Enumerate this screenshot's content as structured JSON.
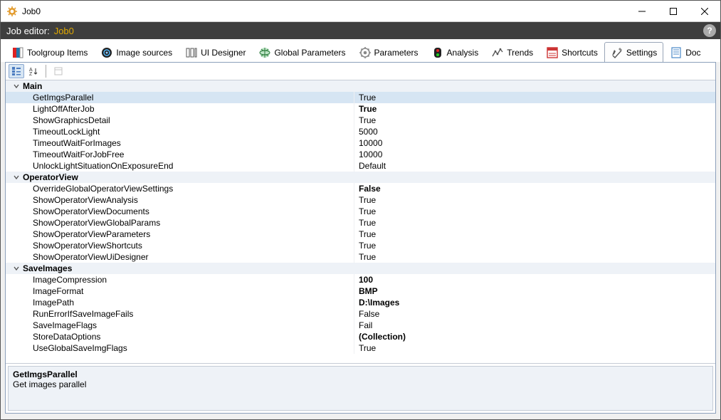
{
  "window": {
    "title": "Job0"
  },
  "editor": {
    "label": "Job editor:",
    "job_name": "Job0"
  },
  "tabs": [
    {
      "label": "Toolgroup Items"
    },
    {
      "label": "Image sources"
    },
    {
      "label": "UI Designer"
    },
    {
      "label": "Global Parameters"
    },
    {
      "label": "Parameters"
    },
    {
      "label": "Analysis"
    },
    {
      "label": "Trends"
    },
    {
      "label": "Shortcuts"
    },
    {
      "label": "Settings"
    },
    {
      "label": "Doc"
    }
  ],
  "categories": [
    {
      "name": "Main",
      "props": [
        {
          "name": "GetImgsParallel",
          "value": "True",
          "bold": false,
          "selected": true
        },
        {
          "name": "LightOffAfterJob",
          "value": "True",
          "bold": true
        },
        {
          "name": "ShowGraphicsDetail",
          "value": "True",
          "bold": false
        },
        {
          "name": "TimeoutLockLight",
          "value": "5000",
          "bold": false
        },
        {
          "name": "TimeoutWaitForImages",
          "value": "10000",
          "bold": false
        },
        {
          "name": "TimeoutWaitForJobFree",
          "value": "10000",
          "bold": false
        },
        {
          "name": "UnlockLightSituationOnExposureEnd",
          "value": "Default",
          "bold": false
        }
      ]
    },
    {
      "name": "OperatorView",
      "props": [
        {
          "name": "OverrideGlobalOperatorViewSettings",
          "value": "False",
          "bold": true
        },
        {
          "name": "ShowOperatorViewAnalysis",
          "value": "True",
          "bold": false
        },
        {
          "name": "ShowOperatorViewDocuments",
          "value": "True",
          "bold": false
        },
        {
          "name": "ShowOperatorViewGlobalParams",
          "value": "True",
          "bold": false
        },
        {
          "name": "ShowOperatorViewParameters",
          "value": "True",
          "bold": false
        },
        {
          "name": "ShowOperatorViewShortcuts",
          "value": "True",
          "bold": false
        },
        {
          "name": "ShowOperatorViewUiDesigner",
          "value": "True",
          "bold": false
        }
      ]
    },
    {
      "name": "SaveImages",
      "props": [
        {
          "name": "ImageCompression",
          "value": "100",
          "bold": true
        },
        {
          "name": "ImageFormat",
          "value": "BMP",
          "bold": true
        },
        {
          "name": "ImagePath",
          "value": "D:\\Images",
          "bold": true
        },
        {
          "name": "RunErrorIfSaveImageFails",
          "value": "False",
          "bold": false
        },
        {
          "name": "SaveImageFlags",
          "value": "Fail",
          "bold": false
        },
        {
          "name": "StoreDataOptions",
          "value": "(Collection)",
          "bold": true
        },
        {
          "name": "UseGlobalSaveImgFlags",
          "value": "True",
          "bold": false
        }
      ]
    }
  ],
  "description": {
    "title": "GetImgsParallel",
    "text": "Get images parallel"
  }
}
